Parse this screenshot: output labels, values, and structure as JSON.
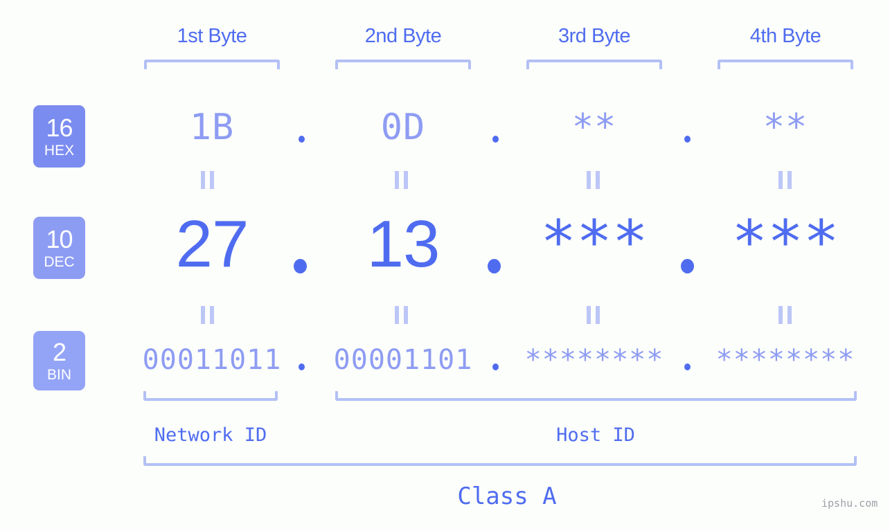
{
  "page": {
    "background": "#fcfefb",
    "accent_dark": "#4f6cf0",
    "accent_light": "#8e9cf3",
    "accent_pale": "#b3c0f5",
    "watermark": "ipshu.com"
  },
  "byte_headers": [
    {
      "label": "1st Byte"
    },
    {
      "label": "2nd Byte"
    },
    {
      "label": "3rd Byte"
    },
    {
      "label": "4th Byte"
    }
  ],
  "rows": [
    {
      "badge": {
        "number": "16",
        "abbr": "HEX",
        "color": "#7b8cf0"
      },
      "values": [
        "1B",
        "0D",
        "**",
        "**"
      ],
      "separator": "."
    },
    {
      "badge": {
        "number": "10",
        "abbr": "DEC",
        "color": "#8d9cf3"
      },
      "values": [
        "27",
        "13",
        "***",
        "***"
      ],
      "separator": "."
    },
    {
      "badge": {
        "number": "2",
        "abbr": "BIN",
        "color": "#93a4f6"
      },
      "values": [
        "00011011",
        "00001101",
        "********",
        "********"
      ],
      "separator": "."
    }
  ],
  "equivalence_symbol": "||",
  "sections": [
    {
      "label": "Network ID"
    },
    {
      "label": "Host ID"
    }
  ],
  "class": {
    "label": "Class A"
  }
}
